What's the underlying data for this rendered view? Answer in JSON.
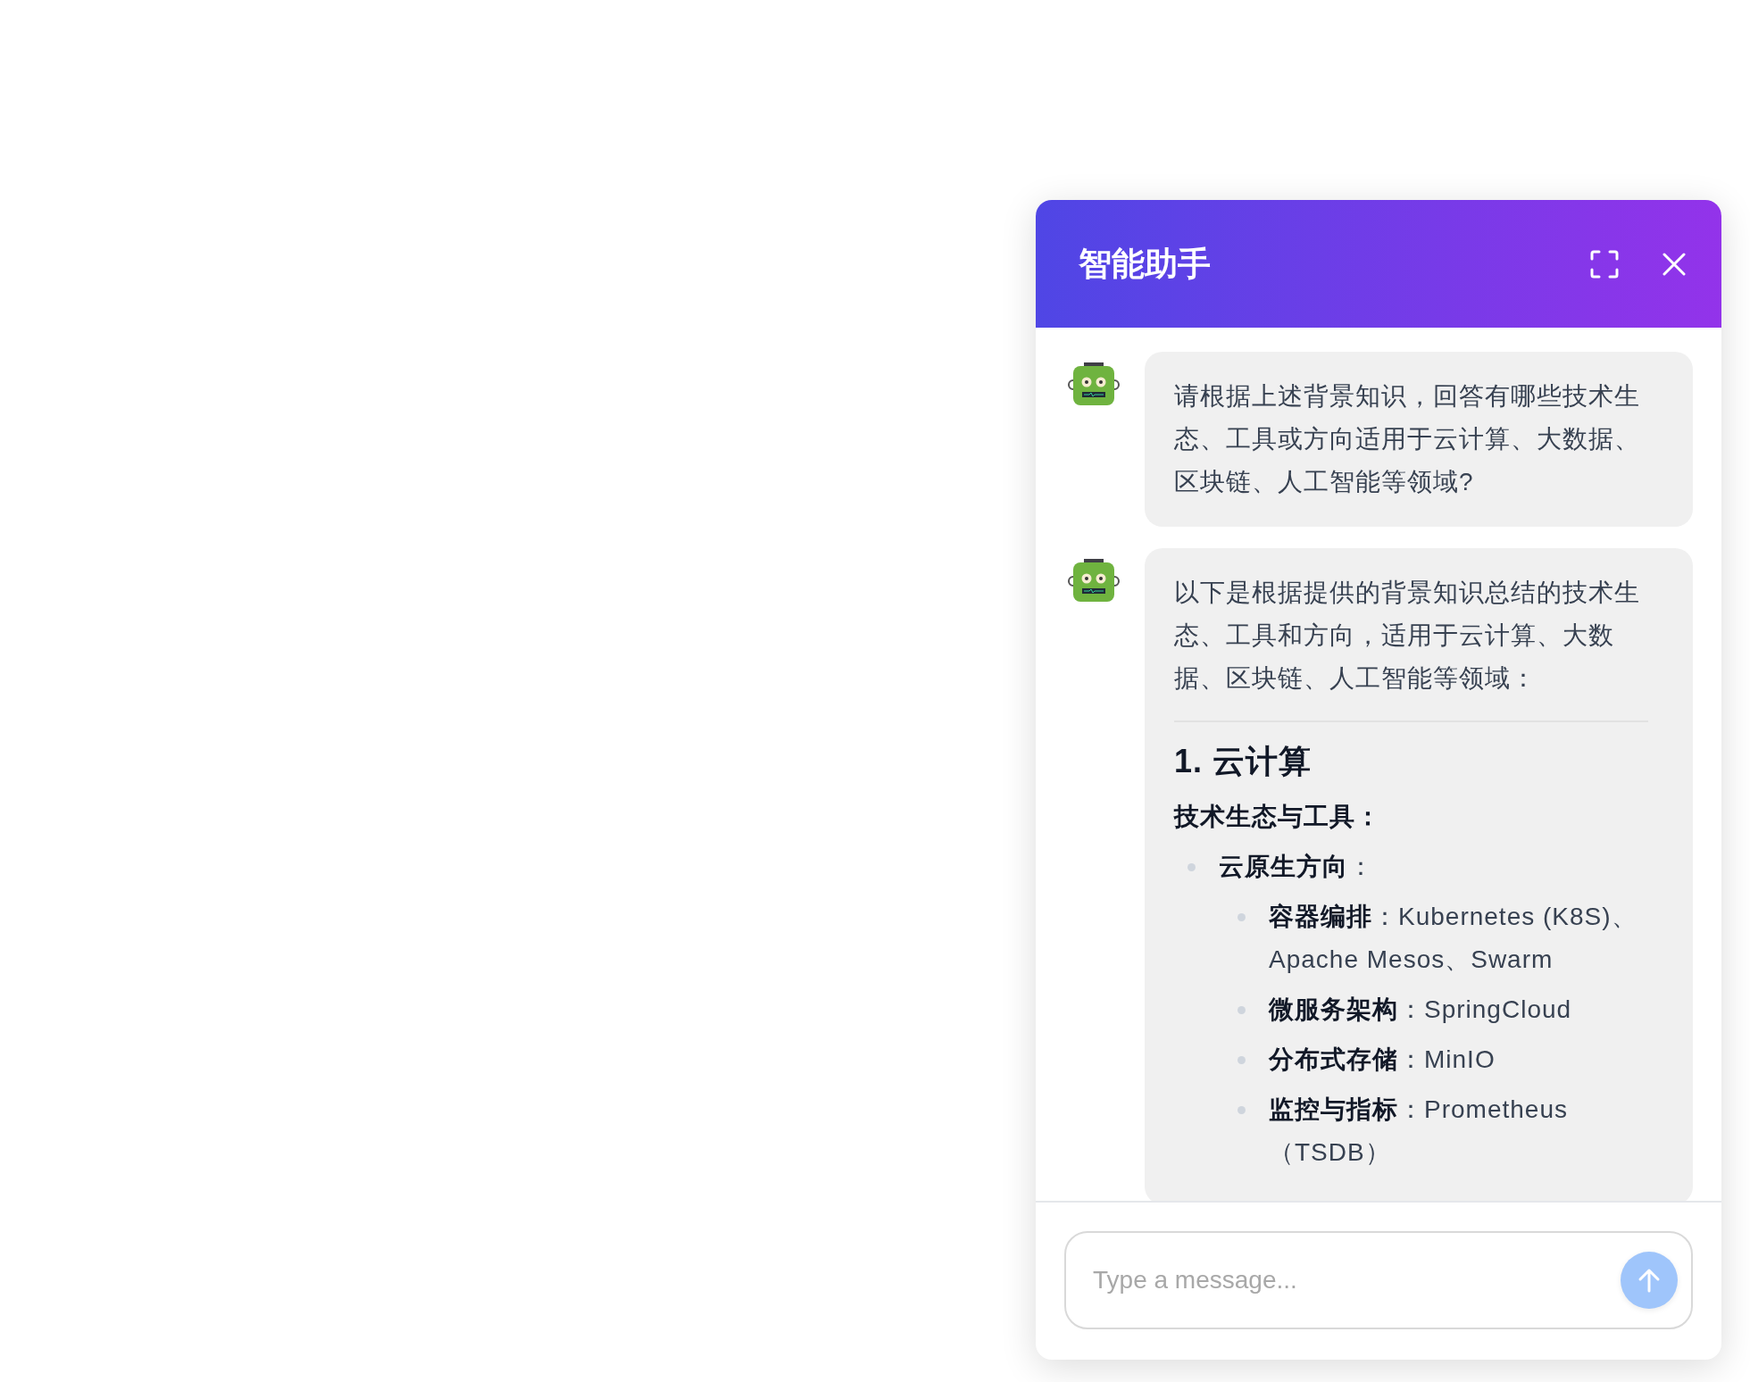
{
  "header": {
    "title": "智能助手"
  },
  "messages": [
    {
      "blocks": [
        {
          "kind": "paragraph",
          "text": "请根据上述背景知识，回答有哪些技术生态、工具或方向适用于云计算、大数据、区块链、人工智能等领域?"
        }
      ]
    },
    {
      "blocks": [
        {
          "kind": "paragraph",
          "text": "以下是根据提供的背景知识总结的技术生态、工具和方向，适用于云计算、大数据、区块链、人工智能等领域："
        },
        {
          "kind": "divider"
        },
        {
          "kind": "heading",
          "text": "1. 云计算"
        },
        {
          "kind": "strong",
          "text": "技术生态与工具："
        },
        {
          "kind": "list",
          "items": [
            {
              "text": "**云原生方向**：",
              "children": [
                {
                  "text": "**容器编排**：Kubernetes (K8S)、Apache Mesos、Swarm"
                },
                {
                  "text": "**微服务架构**：SpringCloud"
                },
                {
                  "text": "**分布式存储**：MinIO"
                },
                {
                  "text": "**监控与指标**：Prometheus（TSDB）"
                }
              ]
            }
          ]
        }
      ]
    }
  ],
  "composer": {
    "placeholder": "Type a message..."
  }
}
